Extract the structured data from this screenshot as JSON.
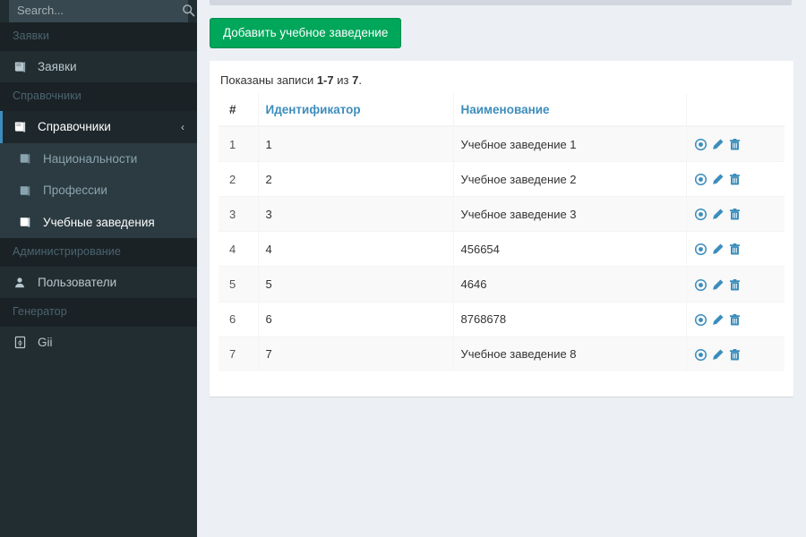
{
  "sidebar": {
    "search": {
      "placeholder": "Search...",
      "value": "",
      "icon": "search-icon"
    },
    "groups": [
      {
        "header": "Заявки",
        "items": [
          {
            "label": "Заявки",
            "icon": "book-icon",
            "active": false
          }
        ]
      },
      {
        "header": "Справочники",
        "items": [
          {
            "label": "Справочники",
            "icon": "book-icon",
            "active": true,
            "chevron": "‹"
          }
        ],
        "children": [
          {
            "label": "Национальности",
            "icon": "book-icon",
            "selected": false
          },
          {
            "label": "Профессии",
            "icon": "book-icon",
            "selected": false
          },
          {
            "label": "Учебные заведения",
            "icon": "book-icon",
            "selected": true
          }
        ]
      },
      {
        "header": "Администрирование",
        "items": [
          {
            "label": "Пользователи",
            "icon": "user-icon",
            "active": false
          }
        ]
      },
      {
        "header": "Генератор",
        "items": [
          {
            "label": "Gii",
            "icon": "file-code-icon",
            "active": false
          }
        ]
      }
    ]
  },
  "main": {
    "add_button_label": "Добавить учебное заведение",
    "summary": {
      "prefix": "Показаны записи ",
      "range": "1-7",
      "middle": " из ",
      "total": "7",
      "suffix": "."
    },
    "table": {
      "columns": [
        "#",
        "Идентификатор",
        "Наименование",
        ""
      ],
      "rows": [
        {
          "num": "1",
          "id": "1",
          "name": "Учебное заведение 1"
        },
        {
          "num": "2",
          "id": "2",
          "name": "Учебное заведение 2"
        },
        {
          "num": "3",
          "id": "3",
          "name": "Учебное заведение 3"
        },
        {
          "num": "4",
          "id": "4",
          "name": "456654"
        },
        {
          "num": "5",
          "id": "5",
          "name": "4646"
        },
        {
          "num": "6",
          "id": "6",
          "name": "8768678"
        },
        {
          "num": "7",
          "id": "7",
          "name": "Учебное заведение 8"
        }
      ],
      "row_actions": [
        {
          "name": "view-icon",
          "title": "Просмотр"
        },
        {
          "name": "edit-icon",
          "title": "Изменить"
        },
        {
          "name": "delete-icon",
          "title": "Удалить"
        }
      ]
    }
  },
  "colors": {
    "sidebar_bg": "#222d32",
    "sidebar_header_bg": "#1a2226",
    "sidebar_sub_bg": "#2c3b41",
    "accent_blue": "#3c8dbc",
    "success_green": "#00a65a",
    "page_bg": "#ecf0f5",
    "link_blue": "#3c8dbc"
  }
}
